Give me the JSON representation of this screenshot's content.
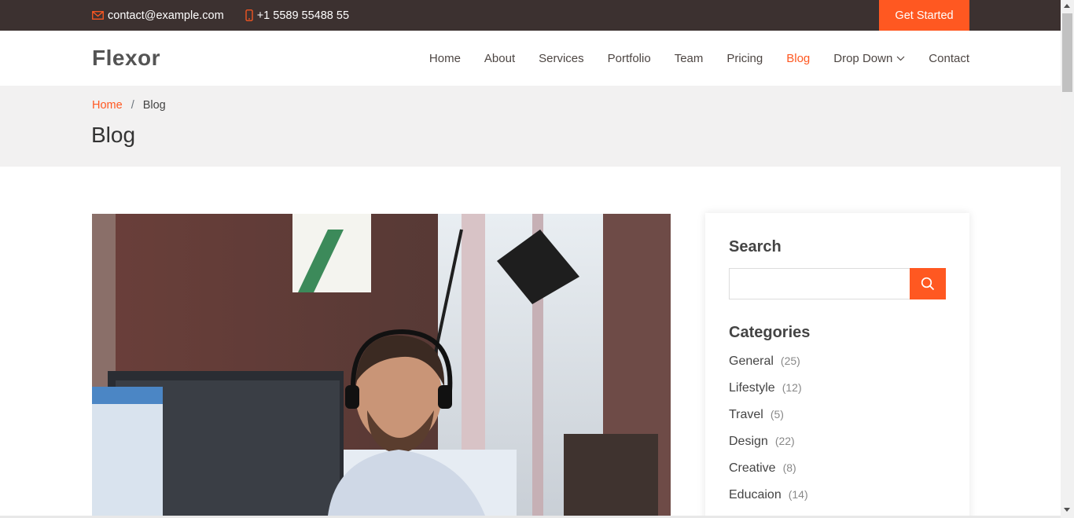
{
  "topbar": {
    "email": "contact@example.com",
    "phone": "+1 5589 55488 55",
    "cta_label": "Get Started",
    "email_icon": "envelope-icon",
    "phone_icon": "phone-icon"
  },
  "header": {
    "logo": "Flexor",
    "nav": [
      {
        "label": "Home"
      },
      {
        "label": "About"
      },
      {
        "label": "Services"
      },
      {
        "label": "Portfolio"
      },
      {
        "label": "Team"
      },
      {
        "label": "Pricing"
      },
      {
        "label": "Blog",
        "active": true
      },
      {
        "label": "Drop Down",
        "dropdown": true
      },
      {
        "label": "Contact"
      }
    ]
  },
  "breadcrumbs": {
    "home": "Home",
    "separator": "/",
    "current": "Blog",
    "title": "Blog"
  },
  "sidebar": {
    "search_title": "Search",
    "search_value": "",
    "search_icon": "search-icon",
    "categories_title": "Categories",
    "categories": [
      {
        "name": "General",
        "count": "(25)"
      },
      {
        "name": "Lifestyle",
        "count": "(12)"
      },
      {
        "name": "Travel",
        "count": "(5)"
      },
      {
        "name": "Design",
        "count": "(22)"
      },
      {
        "name": "Creative",
        "count": "(8)"
      },
      {
        "name": "Educaion",
        "count": "(14)"
      }
    ]
  },
  "colors": {
    "accent": "#ff5821",
    "topbar_bg": "#3c3130",
    "breadcrumb_bg": "#f2f1f1"
  }
}
